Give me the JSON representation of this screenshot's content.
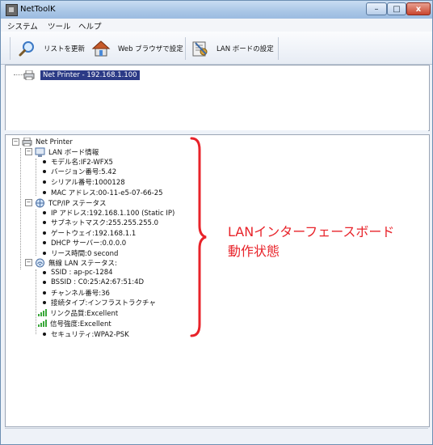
{
  "window": {
    "title": "NetToolK",
    "minimize": "–",
    "maximize": "□",
    "close": "x"
  },
  "menu": [
    "システム",
    "ツール",
    "ヘルプ"
  ],
  "toolbar": {
    "refresh_label": "リストを更新",
    "web_label": "Web ブラウザで設定",
    "lan_label": "LAN ボードの設定"
  },
  "device_list": {
    "item": "Net Printer - 192.168.1.100"
  },
  "tree": {
    "root": "Net Printer",
    "lan_board": {
      "label": "LAN ボード情報",
      "items": [
        "モデル名:IF2-WFX5",
        "バージョン番号:5.42",
        "シリアル番号:1000128",
        "MAC アドレス:00-11-e5-07-66-25"
      ]
    },
    "tcpip": {
      "label": "TCP/IP ステータス",
      "items": [
        "IP アドレス:192.168.1.100 (Static IP)",
        "サブネットマスク:255.255.255.0",
        "ゲートウェイ:192.168.1.1",
        "DHCP サーバー:0.0.0.0",
        "リース時間:0 second"
      ]
    },
    "wlan": {
      "label": "無線 LAN ステータス:",
      "items": [
        "SSID : ap-pc-1284",
        "BSSID : C0:25:A2:67:51:4D",
        "チャンネル番号:36",
        "接続タイプ:インフラストラクチャ",
        "リンク品質:Excellent",
        "信号強度:Excellent",
        "セキュリティ:WPA2-PSK"
      ]
    }
  },
  "annotation": {
    "line1": "LANインターフェースボード",
    "line2": "動作状態"
  },
  "colors": {
    "annotation": "#e8232a",
    "selection": "#2b3a86",
    "signal": "#3aa83a"
  }
}
